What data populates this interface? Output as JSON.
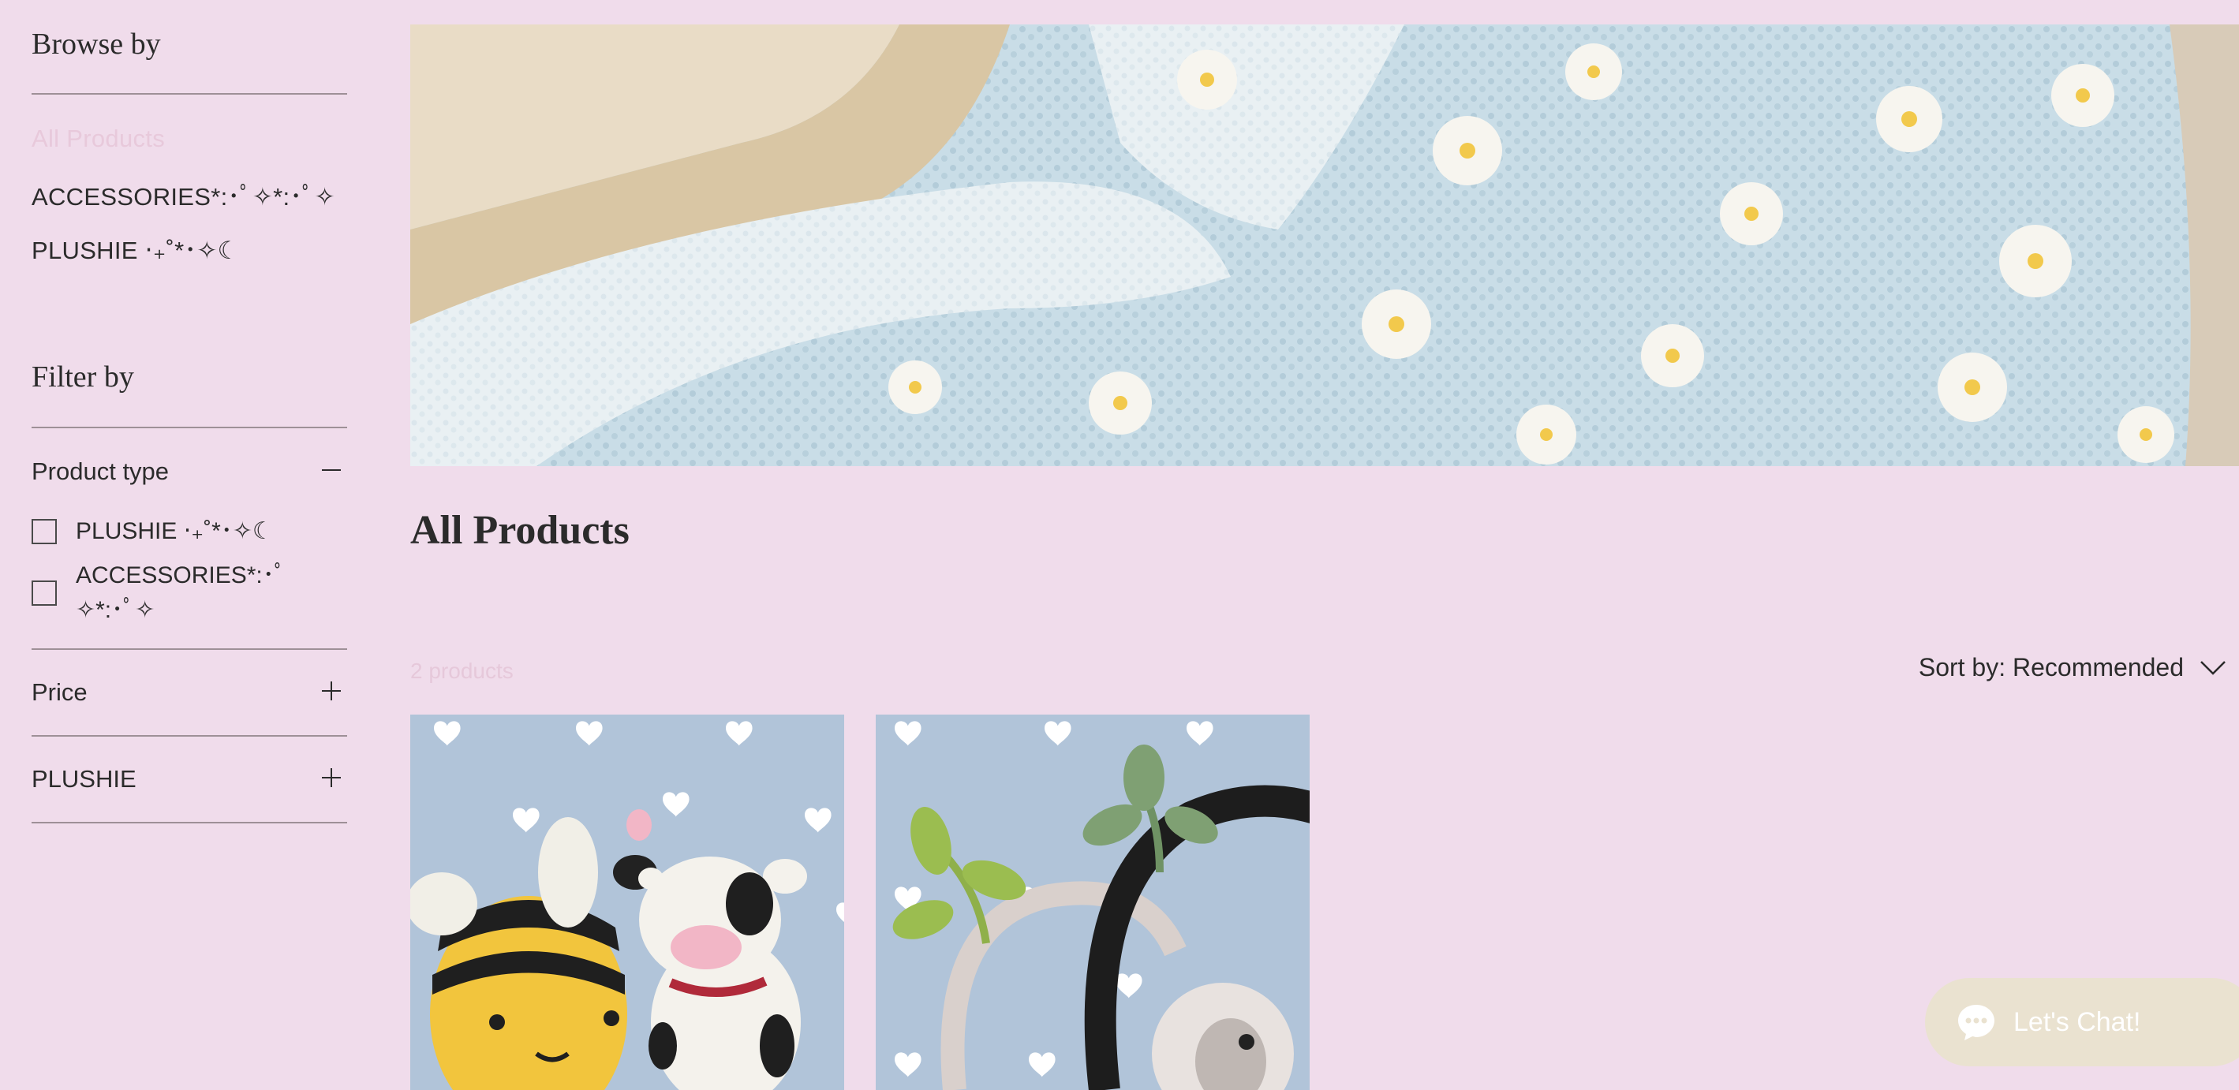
{
  "sidebar": {
    "browse_title": "Browse by",
    "browse_links": [
      {
        "label": "All Products",
        "active": true
      },
      {
        "label": "ACCESSORIES*:･ﾟ✧*:･ﾟ✧",
        "active": false
      },
      {
        "label": "PLUSHIE ‧₊˚*･✧☾",
        "active": false
      }
    ],
    "filter_title": "Filter by",
    "filters": {
      "product_type": {
        "label": "Product type",
        "expanded": true,
        "options": [
          "PLUSHIE ‧₊˚*･✧☾",
          "ACCESSORIES*:･ﾟ✧*:･ﾟ✧"
        ]
      },
      "price": {
        "label": "Price",
        "expanded": false
      },
      "plushie": {
        "label": "PLUSHIE",
        "expanded": false
      }
    }
  },
  "main": {
    "title": "All Products",
    "product_count": "2 products",
    "sort": {
      "label": "Sort by: Recommended"
    },
    "products": [
      {
        "image": "bee-and-cow-plushies"
      },
      {
        "image": "sprout-headphone-accessory"
      }
    ]
  },
  "chat": {
    "label": "Let's Chat!",
    "icon": "chat-bubble-icon"
  },
  "colors": {
    "page_bg": "#f0dceb",
    "text": "#2b2b2b",
    "muted_pink": "#e8c9db",
    "card_blue": "#b1c4d9",
    "chat_bg": "#eae2d0"
  }
}
